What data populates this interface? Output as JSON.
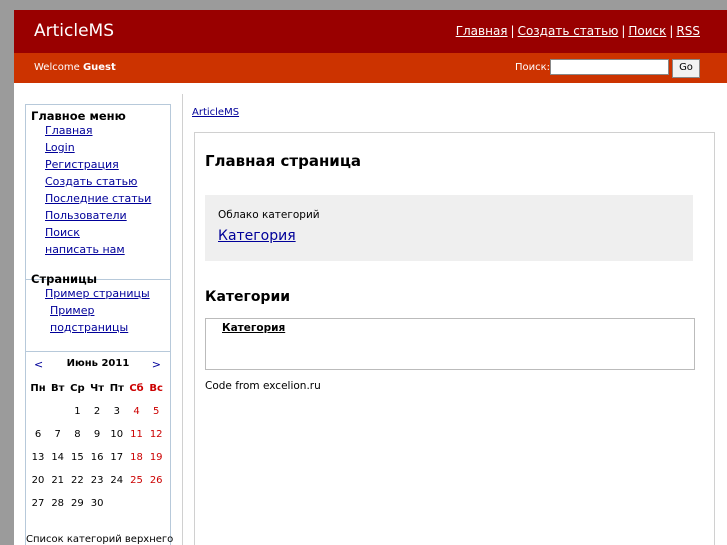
{
  "header": {
    "brand": "ArticleMS",
    "links": [
      "Главная",
      "Создать статью",
      "Поиск",
      "RSS"
    ]
  },
  "subbar": {
    "welcome_prefix": "Welcome",
    "welcome_user": "Guest",
    "search_label": "Поиск:",
    "search_value": "",
    "go_label": "Go"
  },
  "sidebar": {
    "main_menu_title": "Главное меню",
    "main_menu": [
      "Главная",
      "Login",
      "Регистрация",
      "Создать статью",
      "Последние статьи",
      "Пользователи",
      "Поиск",
      "написать нам"
    ],
    "pages_title": "Страницы",
    "pages": [
      "Пример страницы",
      "Пример подстраницы"
    ],
    "calendar": {
      "prev": "<",
      "next": ">",
      "month": "Июнь 2011",
      "weekdays": [
        "Пн",
        "Вт",
        "Ср",
        "Чт",
        "Пт",
        "Сб",
        "Вс"
      ],
      "weeks": [
        [
          "",
          "",
          "1",
          "2",
          "3",
          "4",
          "5"
        ],
        [
          "6",
          "7",
          "8",
          "9",
          "10",
          "11",
          "12"
        ],
        [
          "13",
          "14",
          "15",
          "16",
          "17",
          "18",
          "19"
        ],
        [
          "20",
          "21",
          "22",
          "23",
          "24",
          "25",
          "26"
        ],
        [
          "27",
          "28",
          "29",
          "30",
          "",
          "",
          ""
        ]
      ]
    },
    "footer_text": "Список категорий верхнего"
  },
  "main": {
    "breadcrumb": "ArticleMS",
    "page_title": "Главная страница",
    "cloud_label": "Облако категорий",
    "cloud_link": "Категория",
    "categories_title": "Категории",
    "category_link": "Категория",
    "credit": "Code from excelion.ru"
  },
  "colors": {
    "header": "#990000",
    "subbar": "#cc3300",
    "link": "#000099",
    "weekend": "#cc0000"
  }
}
